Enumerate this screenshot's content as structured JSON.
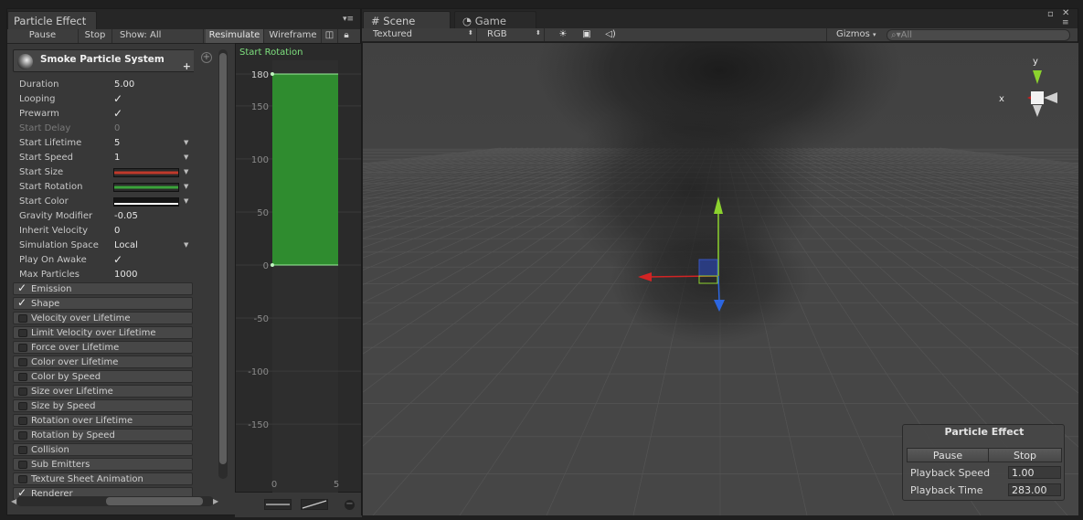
{
  "particle_panel": {
    "tab_title": "Particle Effect",
    "toolbar": {
      "pause": "Pause",
      "stop": "Stop",
      "show": "Show: All",
      "resimulate": "Resimulate",
      "wireframe": "Wireframe"
    },
    "system_name": "Smoke Particle System",
    "properties": [
      {
        "label": "Duration",
        "value": "5.00"
      },
      {
        "label": "Looping",
        "check": true
      },
      {
        "label": "Prewarm",
        "check": true
      },
      {
        "label": "Start Delay",
        "value": "0",
        "disabled": true
      },
      {
        "label": "Start Lifetime",
        "value": "5",
        "dropdown": true
      },
      {
        "label": "Start Speed",
        "value": "1",
        "dropdown": true
      },
      {
        "label": "Start Size",
        "curve_color": "#c0392b",
        "dropdown": true
      },
      {
        "label": "Start Rotation",
        "curve_color": "#3aa33a",
        "dropdown": true
      },
      {
        "label": "Start Color",
        "curve_color": "#ffffff",
        "dropdown": true
      },
      {
        "label": "Gravity Modifier",
        "value": "-0.05"
      },
      {
        "label": "Inherit Velocity",
        "value": "0"
      },
      {
        "label": "Simulation Space",
        "value": "Local",
        "dropdown": true
      },
      {
        "label": "Play On Awake",
        "check": true
      },
      {
        "label": "Max Particles",
        "value": "1000"
      }
    ],
    "modules": [
      {
        "label": "Emission",
        "enabled": true
      },
      {
        "label": "Shape",
        "enabled": true
      },
      {
        "label": "Velocity over Lifetime",
        "enabled": false
      },
      {
        "label": "Limit Velocity over Lifetime",
        "enabled": false
      },
      {
        "label": "Force over Lifetime",
        "enabled": false
      },
      {
        "label": "Color over Lifetime",
        "enabled": false
      },
      {
        "label": "Color by Speed",
        "enabled": false
      },
      {
        "label": "Size over Lifetime",
        "enabled": false
      },
      {
        "label": "Size by Speed",
        "enabled": false
      },
      {
        "label": "Rotation over Lifetime",
        "enabled": false
      },
      {
        "label": "Rotation by Speed",
        "enabled": false
      },
      {
        "label": "Collision",
        "enabled": false
      },
      {
        "label": "Sub Emitters",
        "enabled": false
      },
      {
        "label": "Texture Sheet Animation",
        "enabled": false
      },
      {
        "label": "Renderer",
        "enabled": true
      }
    ]
  },
  "curve_editor": {
    "title": "Start Rotation",
    "title_color": "#7ee07e",
    "fill_color": "#2f8c2f",
    "y_ticks": [
      "180",
      "150",
      "100",
      "50",
      "0",
      "-50",
      "-100",
      "-150"
    ],
    "x_ticks": [
      "0",
      "5"
    ],
    "constant_value": 180,
    "ymin": -180,
    "ymax": 180
  },
  "scene_panel": {
    "tabs": [
      {
        "label": "Scene",
        "icon": "grid-icon",
        "active": true
      },
      {
        "label": "Game",
        "icon": "pacman-icon",
        "active": false
      }
    ],
    "toolbar": {
      "render_mode": "Textured",
      "color_mode": "RGB",
      "gizmos": "Gizmos",
      "search_placeholder": "All"
    },
    "gizmo_axes": {
      "x": "x",
      "y": "y"
    }
  },
  "overlay": {
    "title": "Particle Effect",
    "pause": "Pause",
    "stop": "Stop",
    "playback_speed_label": "Playback Speed",
    "playback_speed": "1.00",
    "playback_time_label": "Playback Time",
    "playback_time": "283.00"
  }
}
